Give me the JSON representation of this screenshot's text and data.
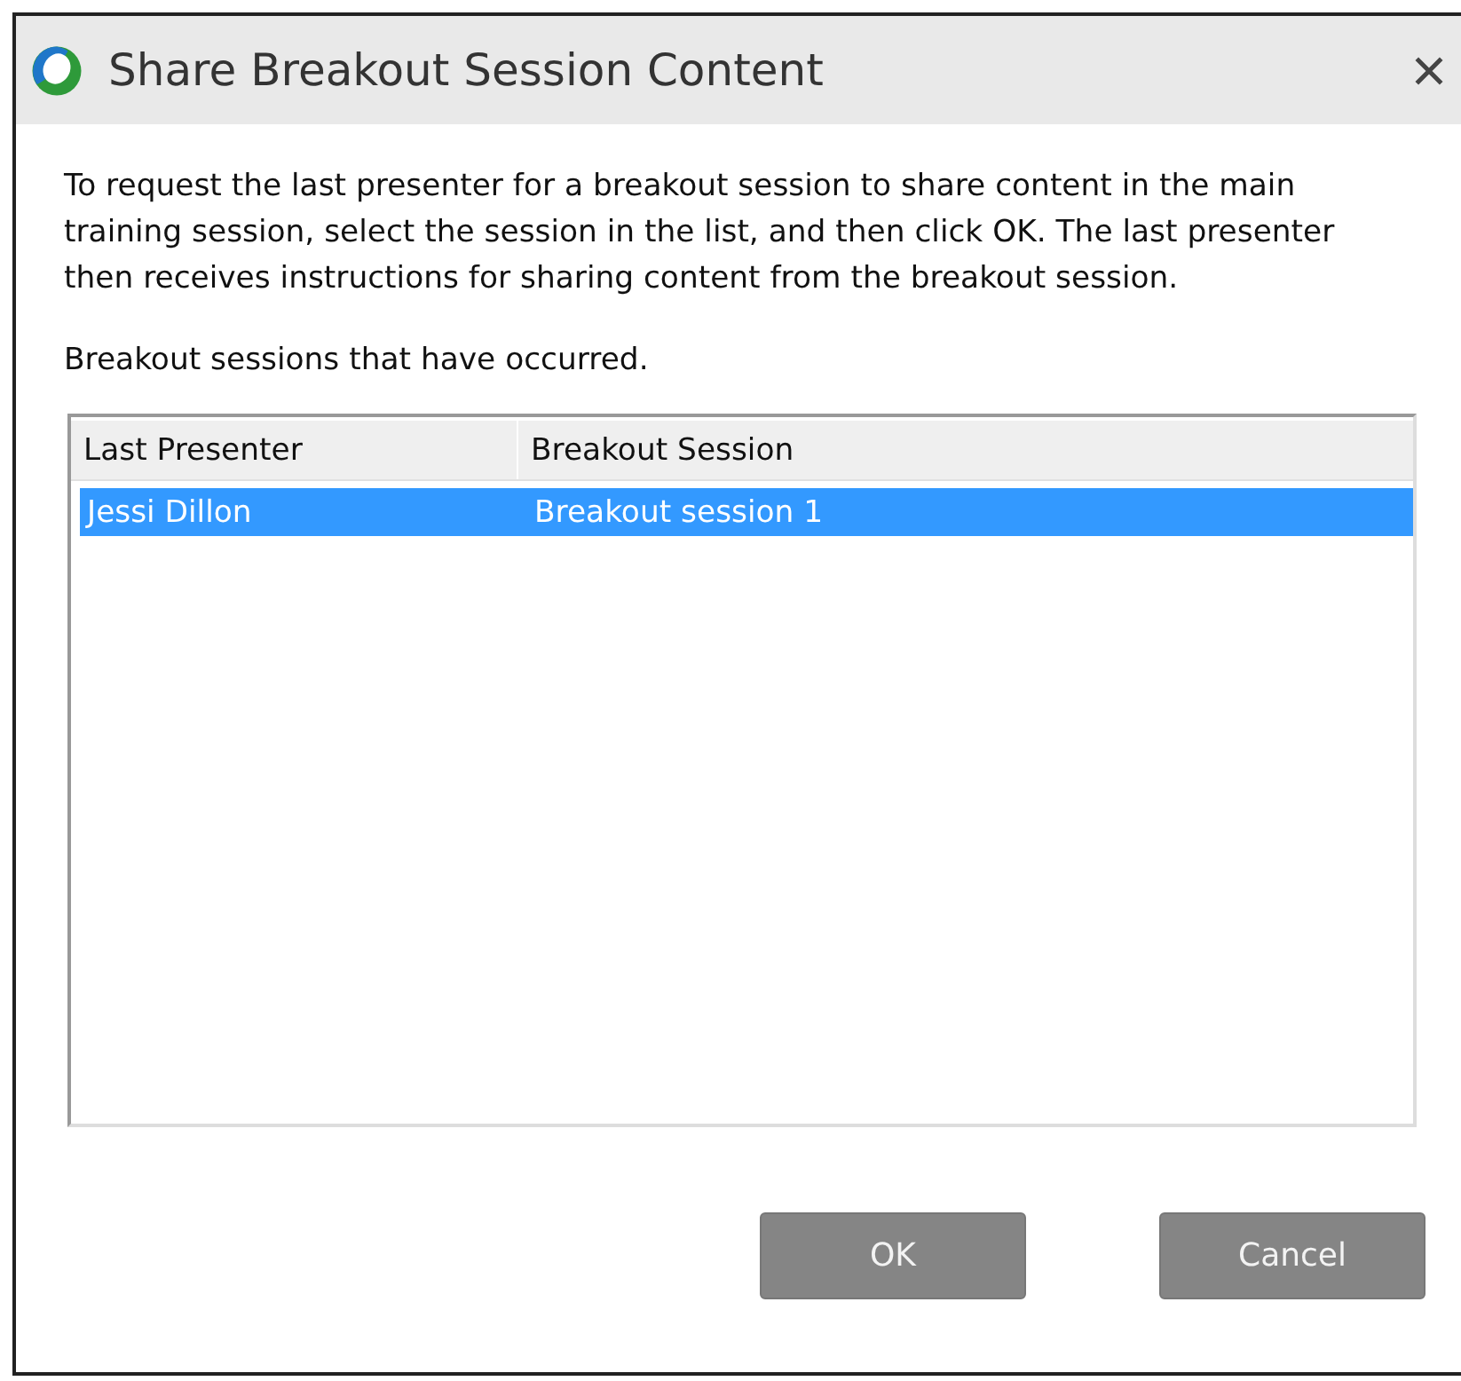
{
  "window": {
    "title": "Share Breakout Session Content"
  },
  "description": "To request the last presenter for a breakout session to share content in the main training session, select the session in the list, and then click OK. The last presenter then receives instructions for sharing content from the breakout session.",
  "list_label": "Breakout sessions that have occurred.",
  "table": {
    "columns": [
      "Last Presenter",
      "Breakout Session"
    ],
    "rows": [
      {
        "cells": [
          "Jessi Dillon",
          "Breakout session 1"
        ],
        "selected": true
      }
    ]
  },
  "buttons": [
    "OK",
    "Cancel"
  ]
}
